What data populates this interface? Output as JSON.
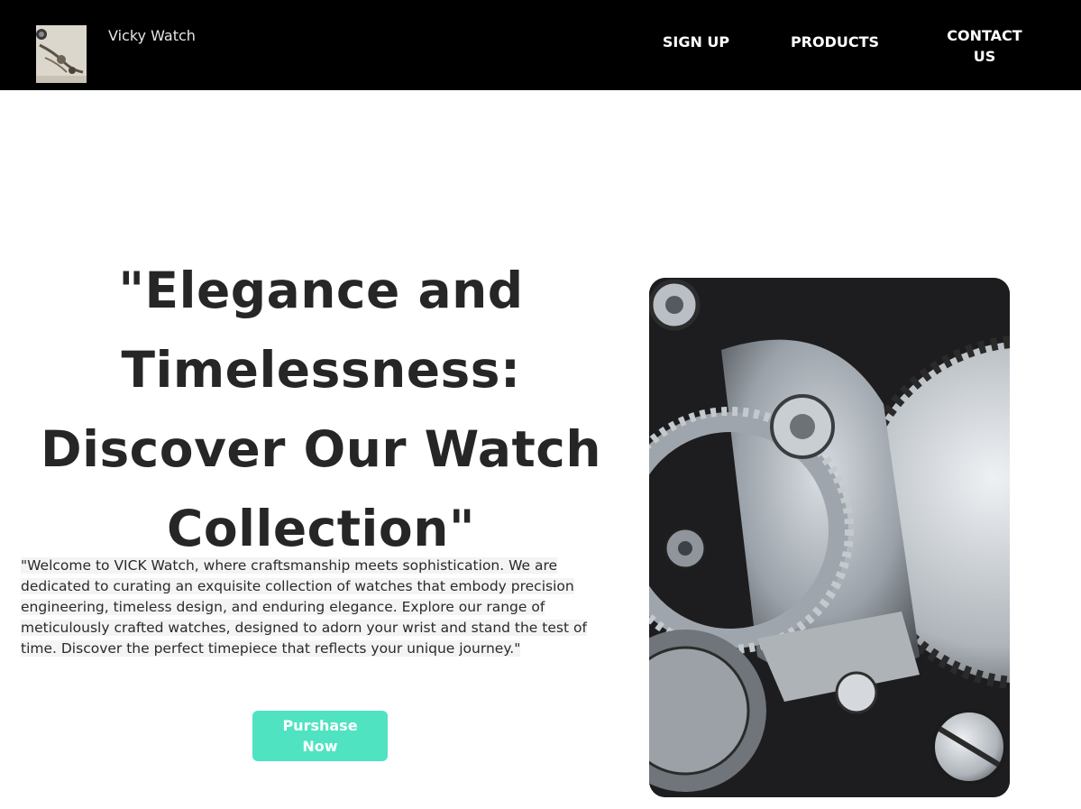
{
  "header": {
    "brand_name": "Vicky Watch",
    "logo_icon": "watch-logo-thumbnail",
    "nav": [
      {
        "label": "SIGN UP"
      },
      {
        "label": "PRODUCTS"
      },
      {
        "label": "CONTACT US"
      }
    ]
  },
  "hero": {
    "title": "\"Elegance and Timelessness: Discover Our Watch Collection\"",
    "description": "\"Welcome to VICK Watch, where craftsmanship meets sophistication. We are dedicated to curating an exquisite collection of watches that embody precision engineering, timeless design, and enduring elegance. Explore our range of meticulously crafted watches, designed to adorn your wrist and stand the test of time. Discover the perfect timepiece that reflects your unique journey.\"",
    "cta_label": "Purshase Now",
    "image_icon": "watch-gears-image"
  },
  "colors": {
    "navbar_bg": "#000000",
    "cta_bg": "#4fe3c1",
    "title_text": "#262626"
  }
}
